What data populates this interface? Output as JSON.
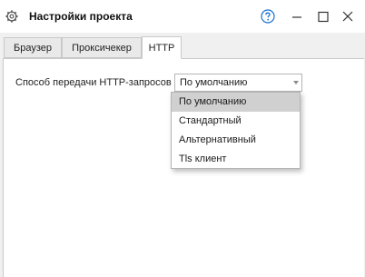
{
  "window": {
    "title": "Настройки проекта",
    "icons": {
      "app": "gear-icon",
      "help": "help-circle-icon",
      "minimize": "minimize-icon",
      "maximize": "maximize-icon",
      "close": "close-icon"
    },
    "accent_color": "#1a6fd6"
  },
  "tabs": [
    {
      "label": "Браузер",
      "active": false
    },
    {
      "label": "Проксичекер",
      "active": false
    },
    {
      "label": "HTTP",
      "active": true
    }
  ],
  "http": {
    "field_label": "Способ передачи HTTP-запросов",
    "selected_value": "По умолчанию",
    "options": [
      "По умолчанию",
      "Стандартный",
      "Альтернативный",
      "Tls клиент"
    ],
    "highlighted_index": 0
  }
}
